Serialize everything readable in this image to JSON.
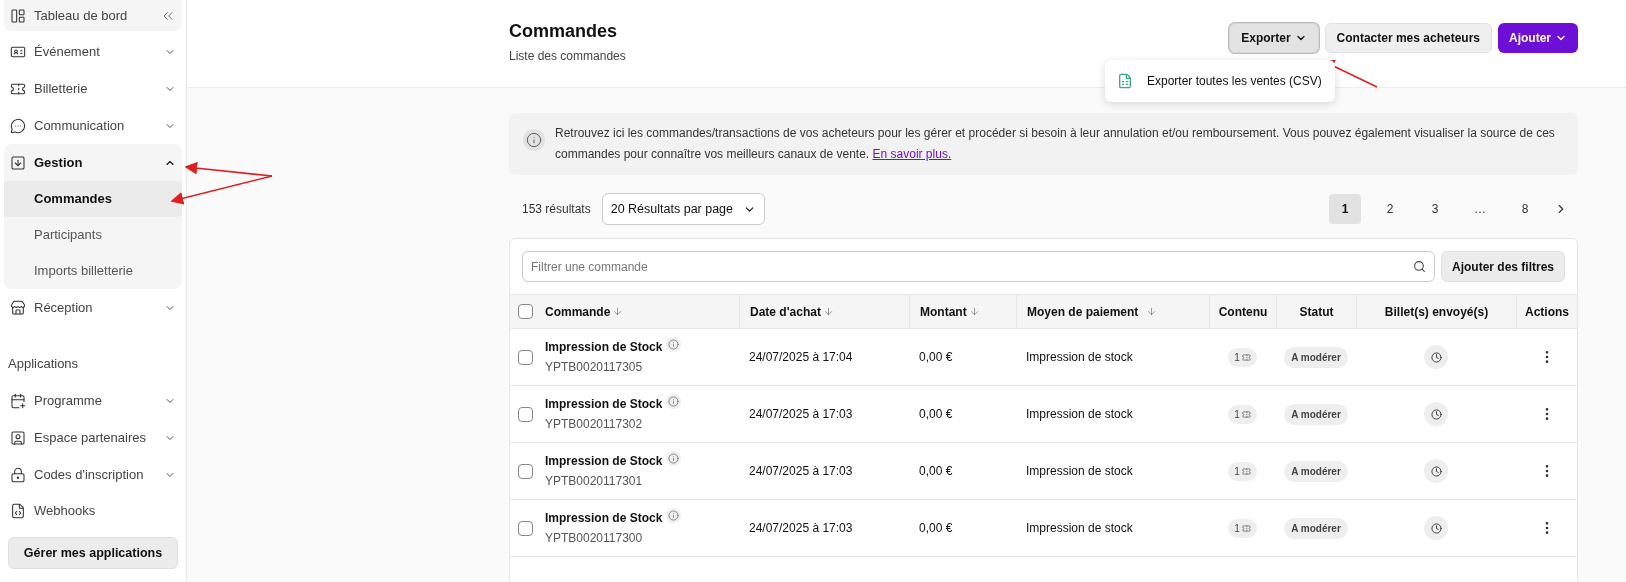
{
  "sidebar": {
    "items": [
      {
        "kind": "item",
        "label": "Tableau de bord"
      },
      {
        "kind": "group",
        "label": "Événement",
        "expanded": false
      },
      {
        "kind": "group",
        "label": "Billetterie",
        "expanded": false
      },
      {
        "kind": "group",
        "label": "Communication",
        "expanded": false
      },
      {
        "kind": "group",
        "label": "Gestion",
        "expanded": true,
        "children": [
          {
            "label": "Commandes",
            "selected": true
          },
          {
            "label": "Participants",
            "selected": false
          },
          {
            "label": "Imports billetterie",
            "selected": false
          }
        ]
      },
      {
        "kind": "group",
        "label": "Réception",
        "expanded": false
      },
      {
        "kind": "section",
        "label": "Applications"
      },
      {
        "kind": "group",
        "label": "Programme",
        "expanded": false
      },
      {
        "kind": "group",
        "label": "Espace partenaires",
        "expanded": false
      },
      {
        "kind": "group",
        "label": "Codes d'inscription",
        "expanded": false
      },
      {
        "kind": "item",
        "label": "Webhooks"
      }
    ],
    "button": "Gérer mes applications"
  },
  "header": {
    "title": "Commandes",
    "subtitle": "Liste des commandes",
    "buttons": [
      {
        "label": "Exporter",
        "kind": "secondary",
        "open": true
      },
      {
        "label": "Contacter mes acheteurs",
        "kind": "plain"
      },
      {
        "label": "Ajouter",
        "kind": "primary"
      }
    ],
    "menu": [
      {
        "label": "Exporter toutes les ventes (CSV)"
      }
    ]
  },
  "notice": {
    "text": "Retrouvez ici les commandes/transactions de vos acheteurs pour les gérer et procéder si besoin à leur annulation et/ou remboursement. Vous pouvez également visualiser la source de ces commandes pour connaître vos meilleurs canaux de vente.",
    "link": "En savoir plus."
  },
  "results": {
    "count": "153 résultats",
    "per_page": "20 Résultats par page"
  },
  "pagination": [
    {
      "label": "1",
      "selected": true
    },
    {
      "label": "2",
      "selected": false
    },
    {
      "label": "3",
      "selected": false
    },
    {
      "label": "…",
      "selected": false
    },
    {
      "label": "8",
      "selected": false
    }
  ],
  "table": {
    "filter_placeholder": "Filtrer une commande",
    "filter_button": "Ajouter des filtres",
    "select_all_checked": false,
    "columns": [
      {
        "label": "Commande"
      },
      {
        "label": "Date d'achat"
      },
      {
        "label": "Montant"
      },
      {
        "label": "Moyen de paiement"
      },
      {
        "label": "Contenu"
      },
      {
        "label": "Statut"
      },
      {
        "label": "Billet(s) envoyé(s)"
      },
      {
        "label": "Actions"
      }
    ],
    "rows": [
      {
        "checked": false,
        "name": "Impression de Stock",
        "code": "YPTB0020117305",
        "date": "24/07/2025 à 17:04",
        "amount": "0,00 €",
        "payment": "Impression de stock",
        "content": "1",
        "status": "A modérer"
      },
      {
        "checked": false,
        "name": "Impression de Stock",
        "code": "YPTB0020117302",
        "date": "24/07/2025 à 17:03",
        "amount": "0,00 €",
        "payment": "Impression de stock",
        "content": "1",
        "status": "A modérer"
      },
      {
        "checked": false,
        "name": "Impression de Stock",
        "code": "YPTB0020117301",
        "date": "24/07/2025 à 17:03",
        "amount": "0,00 €",
        "payment": "Impression de stock",
        "content": "1",
        "status": "A modérer"
      },
      {
        "checked": false,
        "name": "Impression de Stock",
        "code": "YPTB0020117300",
        "date": "24/07/2025 à 17:03",
        "amount": "0,00 €",
        "payment": "Impression de stock",
        "content": "1",
        "status": "A modérer"
      }
    ]
  }
}
